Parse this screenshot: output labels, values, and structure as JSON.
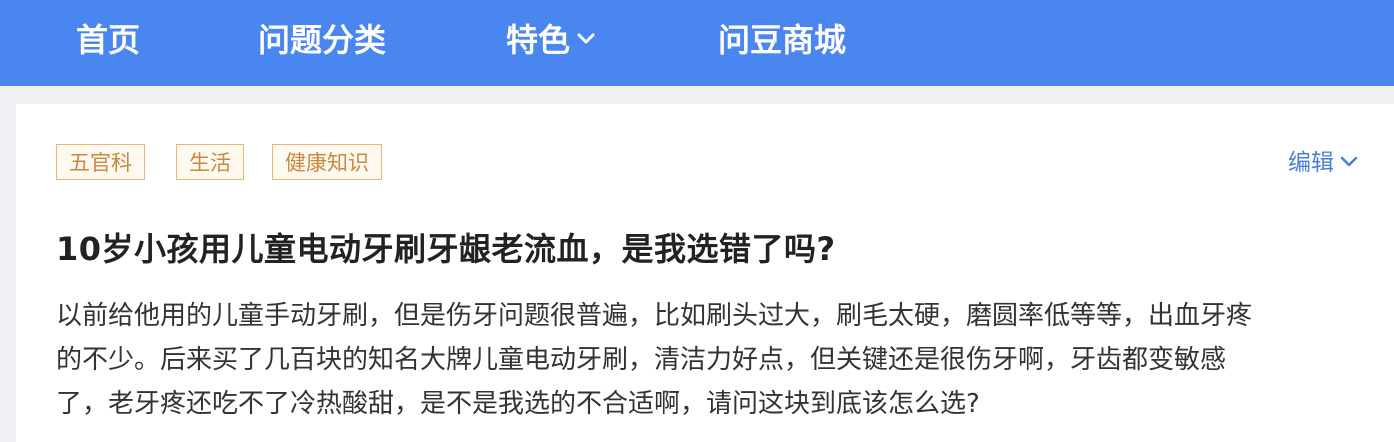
{
  "nav": {
    "items": [
      {
        "label": "首页"
      },
      {
        "label": "问题分类"
      },
      {
        "label": "特色"
      },
      {
        "label": "问豆商城"
      }
    ]
  },
  "question": {
    "tags": [
      "五官科",
      "生活",
      "健康知识"
    ],
    "edit_label": "编辑",
    "title": "10岁小孩用儿童电动牙刷牙龈老流血，是我选错了吗?",
    "body_lines": [
      "以前给他用的儿童手动牙刷，但是伤牙问题很普遍，比如刷头过大，刷毛太硬，磨圆率低等等，出血牙疼",
      "的不少。后来买了几百块的知名大牌儿童电动牙刷，清洁力好点，但关键还是很伤牙啊，牙齿都变敏感",
      "了，老牙疼还吃不了冷热酸甜，是不是我选的不合适啊，请问这块到底该怎么选?"
    ]
  },
  "colors": {
    "nav_bg": "#4a86f0",
    "tag_text": "#c8893f",
    "tag_border": "#e5b77c",
    "link_blue": "#4a7fd8"
  }
}
